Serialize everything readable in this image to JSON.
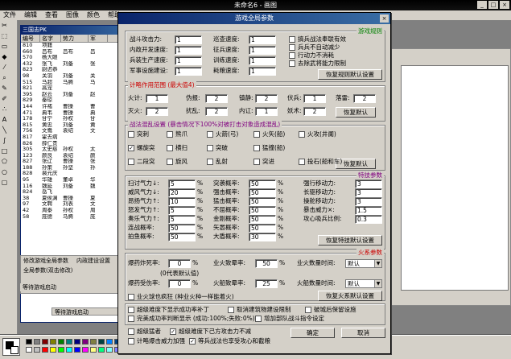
{
  "app": {
    "title": "未命名6 - 画图",
    "window_buttons": [
      "_",
      "□",
      "×"
    ],
    "menu": [
      "文件",
      "编辑",
      "查看",
      "图像",
      "颜色",
      "帮助"
    ]
  },
  "bg_window": {
    "title": "三国志PK",
    "headers": [
      "编号",
      "名字",
      "势力",
      "军"
    ],
    "rows": [
      [
        "810",
        "项籍",
        "",
        "",
        ""
      ],
      [
        "660",
        "吕布",
        "吕布",
        "吕",
        ""
      ],
      [
        "570",
        "杨大眼",
        "",
        "",
        ""
      ],
      [
        "432",
        "张飞",
        "刘备",
        "张",
        ""
      ],
      [
        "823",
        "尉迟恭",
        "",
        "",
        ""
      ],
      [
        "98",
        "关羽",
        "刘备",
        "关",
        ""
      ],
      [
        "515",
        "马超",
        "马腾",
        "马",
        ""
      ],
      [
        "821",
        "高宠",
        "",
        "",
        ""
      ],
      [
        "395",
        "赵云",
        "刘备",
        "赵",
        ""
      ],
      [
        "829",
        "秦琼",
        "",
        "",
        ""
      ],
      [
        "144",
        "许褚",
        "曹操",
        "曹",
        ""
      ],
      [
        "471",
        "典韦",
        "曹操",
        "典",
        ""
      ],
      [
        "178",
        "甘宁",
        "孙权",
        "甘",
        ""
      ],
      [
        "815",
        "黄忠",
        "刘备",
        "黄",
        ""
      ],
      [
        "756",
        "文鸯",
        "袁绍",
        "文",
        ""
      ],
      [
        "817",
        "霍去病",
        "",
        "",
        ""
      ],
      [
        "826",
        "薛仁贵",
        "",
        "",
        ""
      ],
      [
        "305",
        "太史慈",
        "孙权",
        "太",
        ""
      ],
      [
        "123",
        "颜良",
        "袁绍",
        "颜",
        ""
      ],
      [
        "827",
        "张辽",
        "曹操",
        "张",
        ""
      ],
      [
        "188",
        "孙策",
        "孙坚",
        "孙",
        ""
      ],
      [
        "828",
        "裴元庆",
        "",
        "",
        ""
      ],
      [
        "95",
        "华雄",
        "董卓",
        "华",
        ""
      ],
      [
        "116",
        "魏延",
        "刘备",
        "魏",
        ""
      ],
      [
        "824",
        "岳飞",
        "",
        "",
        ""
      ],
      [
        "38",
        "夏侯渊",
        "曹操",
        "夏",
        ""
      ],
      [
        "97",
        "文聘",
        "刘表",
        "文",
        ""
      ],
      [
        "42",
        "周泰",
        "孙权",
        "周",
        ""
      ],
      [
        "58",
        "庞德",
        "马腾",
        "庞",
        ""
      ]
    ],
    "bottom_labels": [
      "修改游戏全局参数",
      "内政建设设置"
    ],
    "bottom_line": "全局参数(双击修改)",
    "status": "等待游戏启动",
    "status2": "等待游戏启动"
  },
  "dialog": {
    "title": "游戏全局参数",
    "close": "×",
    "sec1": {
      "title": "游戏规则",
      "fields": [
        {
          "label": "战斗攻击力:",
          "value": "1"
        },
        {
          "label": "内政开发速度:",
          "value": "1"
        },
        {
          "label": "兵装生产速度:",
          "value": "1"
        },
        {
          "label": "军事设施建设:",
          "value": "1"
        },
        {
          "label": "巡查速度:",
          "value": "1"
        },
        {
          "label": "征兵速度:",
          "value": "1"
        },
        {
          "label": "训练速度:",
          "value": "1"
        },
        {
          "label": "耗粮速度:",
          "value": "1"
        }
      ],
      "checks": [
        "搞兵战法奉联有效",
        "兵兵不自动减少",
        "行动力不消耗",
        "去除武将能力限制"
      ],
      "button": "恢复规则默认设置"
    },
    "sec2": {
      "title": "计略作用范围 (最大值4)",
      "fields": [
        {
          "label": "火计:",
          "value": "1"
        },
        {
          "label": "伪报:",
          "value": "2"
        },
        {
          "label": "镇静:",
          "value": "2"
        },
        {
          "label": "伏兵:",
          "value": "1"
        },
        {
          "label": "落雷:",
          "value": "2"
        },
        {
          "label": "灭火:",
          "value": "2"
        },
        {
          "label": "扰乱:",
          "value": "2"
        },
        {
          "label": "内讧:",
          "value": "1"
        },
        {
          "label": "妖术:",
          "value": "2"
        }
      ],
      "button": "恢复默认"
    },
    "sec3": {
      "title": "战法混乱设置 (暴击情况下100%对被打击对象造成混乱)",
      "items": [
        {
          "label": "突刺",
          "checked": false
        },
        {
          "label": "熊爪",
          "checked": false
        },
        {
          "label": "火箭(弓)",
          "checked": false
        },
        {
          "label": "火矢(船)",
          "checked": false
        },
        {
          "label": "火攻(井阑)",
          "checked": false
        },
        {
          "label": "螺旋突",
          "checked": true
        },
        {
          "label": "横扫",
          "checked": false
        },
        {
          "label": "突破",
          "checked": false
        },
        {
          "label": "猛撞(船)",
          "checked": false
        },
        {
          "label": "二段突",
          "checked": false
        },
        {
          "label": "旋风",
          "checked": false
        },
        {
          "label": "乱射",
          "checked": false
        },
        {
          "label": "突进",
          "checked": false
        },
        {
          "label": "投石(船和车)",
          "checked": false
        }
      ],
      "button": "恢复默认"
    },
    "sec4": {
      "title": "特技参数",
      "col1": [
        {
          "label": "扫讨气力↓:",
          "value": "5"
        },
        {
          "label": "威风气力↓:",
          "value": "20"
        },
        {
          "label": "昂扬气力↑:",
          "value": "10"
        },
        {
          "label": "怒发气力↑:",
          "value": "5"
        },
        {
          "label": "奏乐气力↑:",
          "value": "5"
        },
        {
          "label": "连战概率:",
          "value": "50"
        },
        {
          "label": "拍鱼概率:",
          "value": "50"
        }
      ],
      "col2": [
        {
          "label": "突袭概率:",
          "value": "50"
        },
        {
          "label": "强击概率:",
          "value": "50"
        },
        {
          "label": "猛击概率:",
          "value": "50"
        },
        {
          "label": "不屈概率:",
          "value": "50"
        },
        {
          "label": "金刚概率:",
          "value": "50"
        },
        {
          "label": "矢嚣概率:",
          "value": "50"
        },
        {
          "label": "大盾概率:",
          "value": "30"
        }
      ],
      "col3": [
        {
          "label": "强行移动力:",
          "value": "3"
        },
        {
          "label": "长驱移动力:",
          "value": "3"
        },
        {
          "label": "操舵移动力:",
          "value": "3"
        },
        {
          "label": "暴击威力×:",
          "value": "1.5"
        },
        {
          "label": "攻心吸兵比例:",
          "value": "0.3"
        }
      ],
      "percent": "%",
      "button": "恢复特技默认设置"
    },
    "sec5": {
      "title": "火系参数",
      "row1": [
        {
          "label": "爆药炸死率:",
          "value": "0"
        },
        {
          "label": "业火致晕率:",
          "value": "50"
        },
        {
          "label": "业火数量时间:",
          "value": "默认"
        }
      ],
      "note": "(0代表默认值)",
      "row2": [
        {
          "label": "爆药受伤率:",
          "value": "0"
        },
        {
          "label": "火船致晕率:",
          "value": "25"
        },
        {
          "label": "火船数量时间:",
          "value": "默认"
        }
      ],
      "check_row": "业火球也疯狂 (种业火种一样能着火)",
      "button": "恢复火系默认设置"
    },
    "sec6": {
      "items": [
        {
          "label": "超级难度下显示成功率补丁",
          "checked": false
        },
        {
          "label": "取消建筑物建设限制",
          "checked": false
        },
        {
          "label": "破城后保留设施",
          "checked": false
        },
        {
          "label": "完美成功率判断显示 (成功:100%;失败:0%)",
          "checked": false
        },
        {
          "label": "增加部队战斗指令设定",
          "checked": false
        },
        {
          "label": "超级难度下己方攻击力不减",
          "checked": true
        },
        {
          "label": "超级猛者",
          "checked": false
        },
        {
          "label": "计略爆击威力加强",
          "checked": false
        },
        {
          "label": "等兵战法也享受攻心和截粮",
          "checked": true
        }
      ]
    },
    "ok": "确定",
    "cancel": "取消"
  },
  "palette": {
    "colors": [
      "#000000",
      "#808080",
      "#800000",
      "#808000",
      "#008000",
      "#008080",
      "#000080",
      "#800080",
      "#808040",
      "#004040",
      "#0080ff",
      "#004080",
      "#8000ff",
      "#804000",
      "#ffffff",
      "#c0c0c0",
      "#ff0000",
      "#ffff00",
      "#00ff00",
      "#00ffff",
      "#0000ff",
      "#ff00ff",
      "#ffff80",
      "#00ff80",
      "#80ffff",
      "#8080ff",
      "#ff0080",
      "#ff8040"
    ]
  }
}
